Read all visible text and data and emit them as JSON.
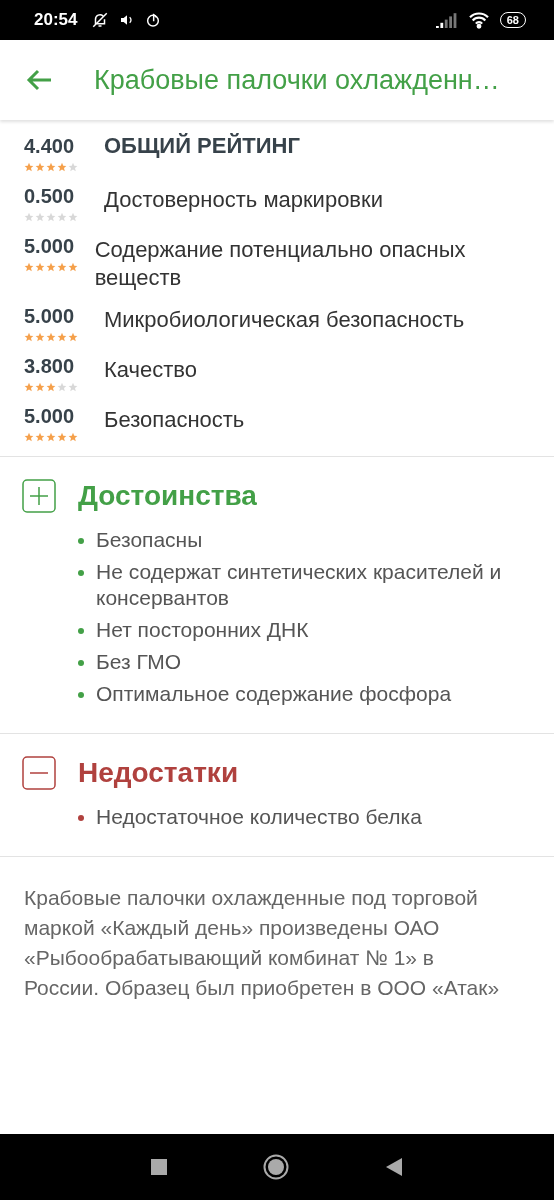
{
  "status_bar": {
    "time": "20:54",
    "battery": "68"
  },
  "header": {
    "title": "Крабовые палочки охлажденн…"
  },
  "ratings": [
    {
      "kind": "overall",
      "score": "4.400",
      "label": "ОБЩИЙ РЕЙТИНГ",
      "stars": 4
    },
    {
      "kind": "criterion",
      "score": "0.500",
      "label": "Достоверность маркировки",
      "stars": 0
    },
    {
      "kind": "criterion",
      "score": "5.000",
      "label": "Содержание потенциально опасных веществ",
      "stars": 5
    },
    {
      "kind": "criterion",
      "score": "5.000",
      "label": "Микробиологическая безопасность",
      "stars": 5
    },
    {
      "kind": "criterion",
      "score": "3.800",
      "label": "Качество",
      "stars": 3
    },
    {
      "kind": "criterion",
      "score": "5.000",
      "label": "Безопасность",
      "stars": 5
    }
  ],
  "sections": [
    {
      "kind": "pros",
      "title": "Достоинства",
      "items": [
        "Безопасны",
        "Не содержат синтетических красителей и консервантов",
        "Нет посторонних ДНК",
        "Без ГМО",
        "Оптимальное содержание фосфора"
      ]
    },
    {
      "kind": "cons",
      "title": "Недостатки",
      "items": [
        "Недостаточное количество белка"
      ]
    }
  ],
  "description": "Крабовые палочки охлажденные под торговой маркой «Каждый день» произведены ОАО «Рыбообрабатывающий комбинат № 1» в России. Образец был приобретен в ООО «Атак»"
}
